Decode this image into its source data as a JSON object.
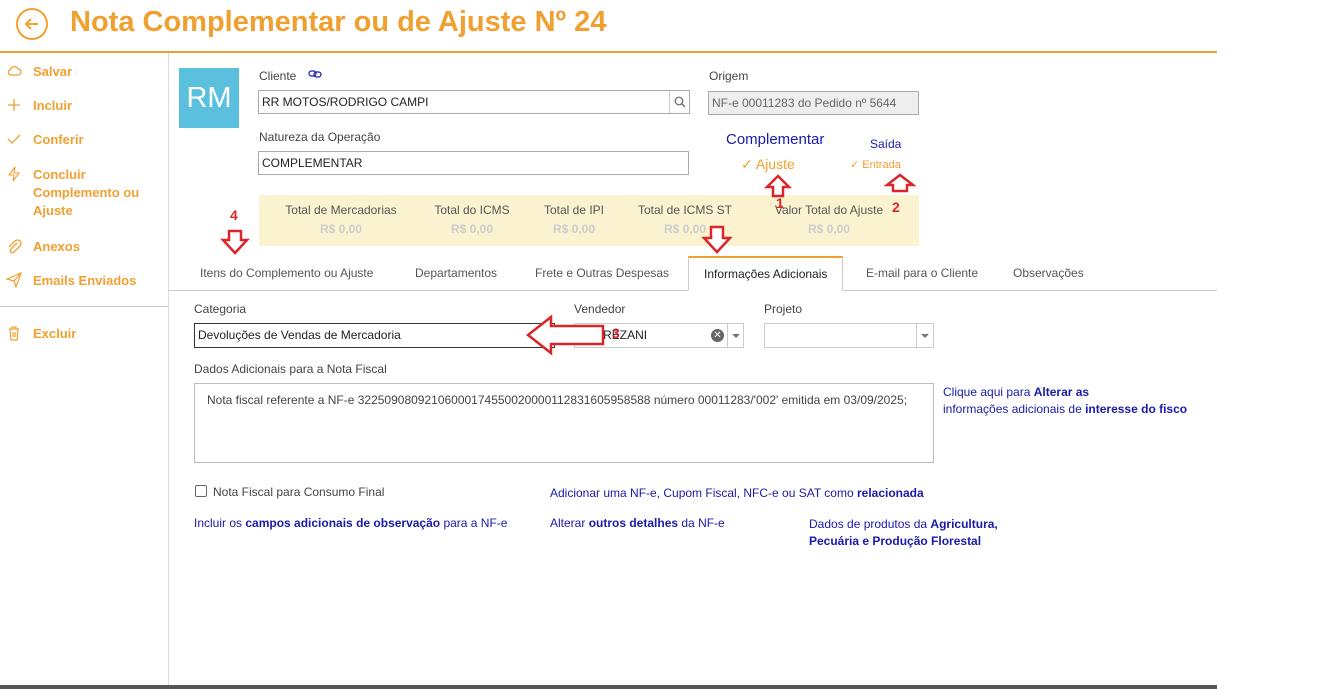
{
  "header": {
    "title": "Nota Complementar ou de Ajuste Nº 24"
  },
  "sidebar": {
    "items": [
      {
        "label": "Salvar",
        "icon": "cloud-icon"
      },
      {
        "label": "Incluir",
        "icon": "plus-icon"
      },
      {
        "label": "Conferir",
        "icon": "check-icon"
      },
      {
        "label": "Concluir Complemento ou Ajuste",
        "icon": "lightning-icon"
      },
      {
        "label": "Anexos",
        "icon": "paperclip-icon"
      },
      {
        "label": "Emails Enviados",
        "icon": "paper-plane-icon"
      },
      {
        "label": "Excluir",
        "icon": "trash-icon"
      }
    ]
  },
  "avatar": {
    "initials": "RM"
  },
  "form": {
    "cliente_label": "Cliente",
    "cliente_value": "RR MOTOS/RODRIGO CAMPI",
    "natureza_label": "Natureza da Operação",
    "natureza_value": "COMPLEMENTAR",
    "origem_label": "Origem",
    "origem_value": "NF-e 00011283 do Pedido nº 5644"
  },
  "toggles": {
    "complementar": "Complementar",
    "ajuste": "Ajuste",
    "saida": "Saída",
    "entrada": "Entrada"
  },
  "annotations": {
    "n1": "1",
    "n2": "2",
    "n3": "3",
    "n4": "4"
  },
  "totals": [
    {
      "label": "Total de Mercadorias",
      "value": "R$ 0,00"
    },
    {
      "label": "Total do ICMS",
      "value": "R$ 0,00"
    },
    {
      "label": "Total de IPI",
      "value": "R$ 0,00"
    },
    {
      "label": "Total de ICMS ST",
      "value": "R$ 0,00"
    },
    {
      "label": "Valor Total do Ajuste",
      "value": "R$ 0,00"
    }
  ],
  "tabs": [
    "Itens do Complemento ou Ajuste",
    "Departamentos",
    "Frete e Outras Despesas",
    "Informações Adicionais",
    "E-mail para o Cliente",
    "Observações"
  ],
  "info": {
    "categoria_label": "Categoria",
    "categoria_value": "Devoluções de Vendas de Mercadoria",
    "vendedor_label": "Vendedor",
    "vendedor_value": "TORREZANI",
    "projeto_label": "Projeto",
    "projeto_value": "",
    "dados_label": "Dados Adicionais para a Nota Fiscal",
    "dados_value": "Nota fiscal referente a NF-e 32250908092106000174550020000112831605958588 número 00011283/'002' emitida em 03/09/2025;",
    "fisco_link_pre": "Clique aqui para ",
    "fisco_link_b1": "Alterar as",
    "fisco_link_mid": "informações adicionais de ",
    "fisco_link_b2": "interesse do fisco",
    "consumo_label": "Nota Fiscal para Consumo Final",
    "rel_pre": "Adicionar uma NF-e, Cupom Fiscal, NFC-e ou SAT como ",
    "rel_b": "relacionada",
    "campos_pre": "Incluir os ",
    "campos_b": "campos adicionais de observação",
    "campos_post": " para a NF-e",
    "detalhes_pre": "Alterar ",
    "detalhes_b": "outros detalhes",
    "detalhes_post": " da NF-e",
    "agri_pre": "Dados de produtos da ",
    "agri_b1": "Agricultura,",
    "agri_b2": "Pecuária e Produção Florestal"
  },
  "colors": {
    "accent": "#f0a030",
    "link": "#1a1aaa",
    "annotation": "#d9262b",
    "avatar": "#5bc0de"
  }
}
